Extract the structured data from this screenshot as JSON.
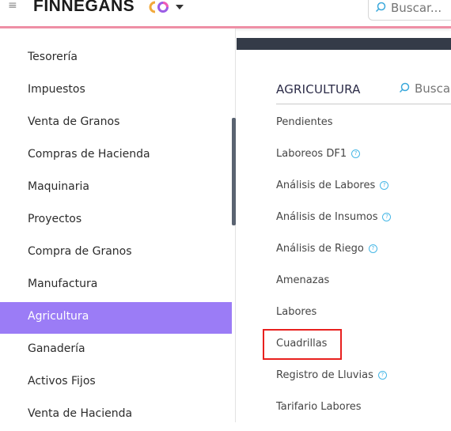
{
  "header": {
    "brand": "FINNEGANS",
    "brand_colors": {
      "c_orange": "#f2a93b",
      "o_purple": "#9b5de5",
      "o_pink": "#f15bb5"
    },
    "search": {
      "placeholder": "Buscar..."
    },
    "accent_line": "#ee8fa5"
  },
  "sidebar": {
    "items": [
      {
        "label": "Tesorería",
        "active": false
      },
      {
        "label": "Impuestos",
        "active": false
      },
      {
        "label": "Venta de Granos",
        "active": false
      },
      {
        "label": "Compras de Hacienda",
        "active": false
      },
      {
        "label": "Maquinaria",
        "active": false
      },
      {
        "label": "Proyectos",
        "active": false
      },
      {
        "label": "Compra de Granos",
        "active": false
      },
      {
        "label": "Manufactura",
        "active": false
      },
      {
        "label": "Agricultura",
        "active": true
      },
      {
        "label": "Ganadería",
        "active": false
      },
      {
        "label": "Activos Fijos",
        "active": false
      },
      {
        "label": "Venta de Hacienda",
        "active": false
      }
    ],
    "active_color": "#9b7cf6"
  },
  "panel": {
    "title": "AGRICULTURA",
    "search": {
      "placeholder": "Buscar"
    },
    "items": [
      {
        "label": "Pendientes",
        "help": false
      },
      {
        "label": "Laboreos DF1",
        "help": true
      },
      {
        "label": "Análisis de Labores",
        "help": true
      },
      {
        "label": "Análisis de Insumos",
        "help": true
      },
      {
        "label": "Análisis de Riego",
        "help": true
      },
      {
        "label": "Amenazas",
        "help": false
      },
      {
        "label": "Labores",
        "help": false
      },
      {
        "label": "Cuadrillas",
        "help": false,
        "highlighted": true
      },
      {
        "label": "Registro de Lluvias",
        "help": true
      },
      {
        "label": "Tarifario Labores",
        "help": false
      }
    ],
    "help_icon_glyph": "?",
    "highlight_color": "#e8201e"
  }
}
